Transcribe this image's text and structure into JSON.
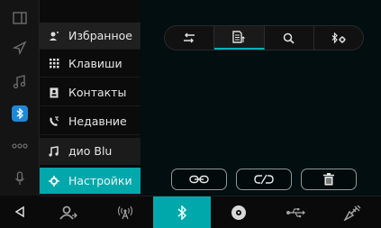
{
  "accent_color": "#00a8ab",
  "rail": {
    "icons": [
      "split-screen-icon",
      "navigation-icon",
      "music-icon",
      "bluetooth-icon",
      "apps-icon",
      "microphone-icon"
    ],
    "back_icon": "back-arrow-icon"
  },
  "menu": {
    "items": [
      {
        "label": "Избранное",
        "icon": "favorites-icon",
        "state": "dim"
      },
      {
        "label": "Клавиши",
        "icon": "keypad-icon",
        "state": "normal"
      },
      {
        "label": "Контакты",
        "icon": "contacts-icon",
        "state": "normal"
      },
      {
        "label": "Недавние",
        "icon": "recent-calls-icon",
        "state": "normal"
      },
      {
        "label": "дио      Blu",
        "icon": "bt-audio-icon",
        "state": "dim"
      },
      {
        "label": "Настройки",
        "icon": "settings-icon",
        "state": "active"
      }
    ]
  },
  "main": {
    "tabs": [
      "transfer-icon",
      "device-list-icon",
      "search-icon",
      "bt-settings-icon"
    ],
    "active_tab_index": 1,
    "actions": [
      "connect-icon",
      "disconnect-icon",
      "delete-icon"
    ]
  },
  "bottombar": {
    "buttons": [
      "contacts-mode-icon",
      "radio-icon",
      "bluetooth-mode-icon",
      "disc-icon",
      "usb-icon",
      "settings-mode-icon"
    ],
    "active_index": 2
  }
}
